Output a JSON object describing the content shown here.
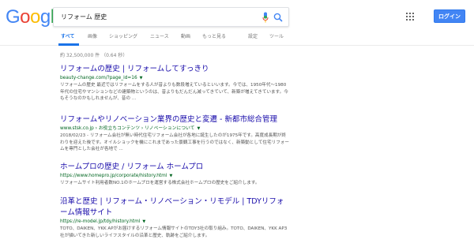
{
  "logo": [
    "G",
    "o",
    "o",
    "g",
    "l",
    "e"
  ],
  "logo_colors": [
    "#4285f4",
    "#ea4335",
    "#fbbc05",
    "#4285f4",
    "#34a853",
    "#ea4335"
  ],
  "search": {
    "query": "リフォーム 歴史"
  },
  "header": {
    "login_label": "ログイン"
  },
  "tabs": [
    {
      "label": "すべて"
    },
    {
      "label": "画像"
    },
    {
      "label": "ショッピング"
    },
    {
      "label": "ニュース"
    },
    {
      "label": "動画"
    },
    {
      "label": "もっと見る"
    },
    {
      "label": "設定"
    },
    {
      "label": "ツール"
    }
  ],
  "stats": "約 32,500,000 件 （0.64 秒）",
  "results": [
    {
      "title": "リフォームの歴史 | リフォームしてすっきり",
      "url": "beauty-change.com/?page_id=16",
      "snippet": "リフォームの歴史 最近ではリフォームをする人が昔よりも数段増えているといいます。今では、1950年代〜1980年代の住宅やマンションなどの建築物というのは、昔よりもだんだん減ってきていて、新築が増えてきています。今もそうなのかもしれませんが、昔の ..."
    },
    {
      "title": "リフォームやリノベーション業界の歴史と変遷 - 新都市総合管理",
      "url": "www.stsk.co.jp › お役立ちコンテンツ › リノベーションについて",
      "snippet": "2018/02/23 - リフォーム会社が無い時代住宅リフォーム会社が各地に誕生したのが1975年です。高度成長期が終わりを迎えた後です。オイルショックを機にこれまであった景観工事を行うのではなく、新築動として住宅リフォームを専門とした会社が各地で ..."
    },
    {
      "title": "ホームプロの歴史 / リフォーム ホームプロ",
      "url": "https://www.homepro.jp/corporate/history.html",
      "snippet": "リフォームサイト利用者数NO.1のホームプロを運営する株式会社ホームプロの歴史をご紹介します。"
    },
    {
      "title": "沿革と歴史 | リフォーム・リノベーション・リモデル | TDYリフォーム情報サイト",
      "url": "https://re-model.jp/tdy/history.html",
      "snippet": "TOTO、DAIKEN、YKK APがお届けするリフォーム情報サイトのTDY3社の取り組み。TOTO、DAIKEN、YKK AP3社が描いてきた新しいライフスタイルの沿革と歴史、軌跡をご紹介します。"
    }
  ]
}
